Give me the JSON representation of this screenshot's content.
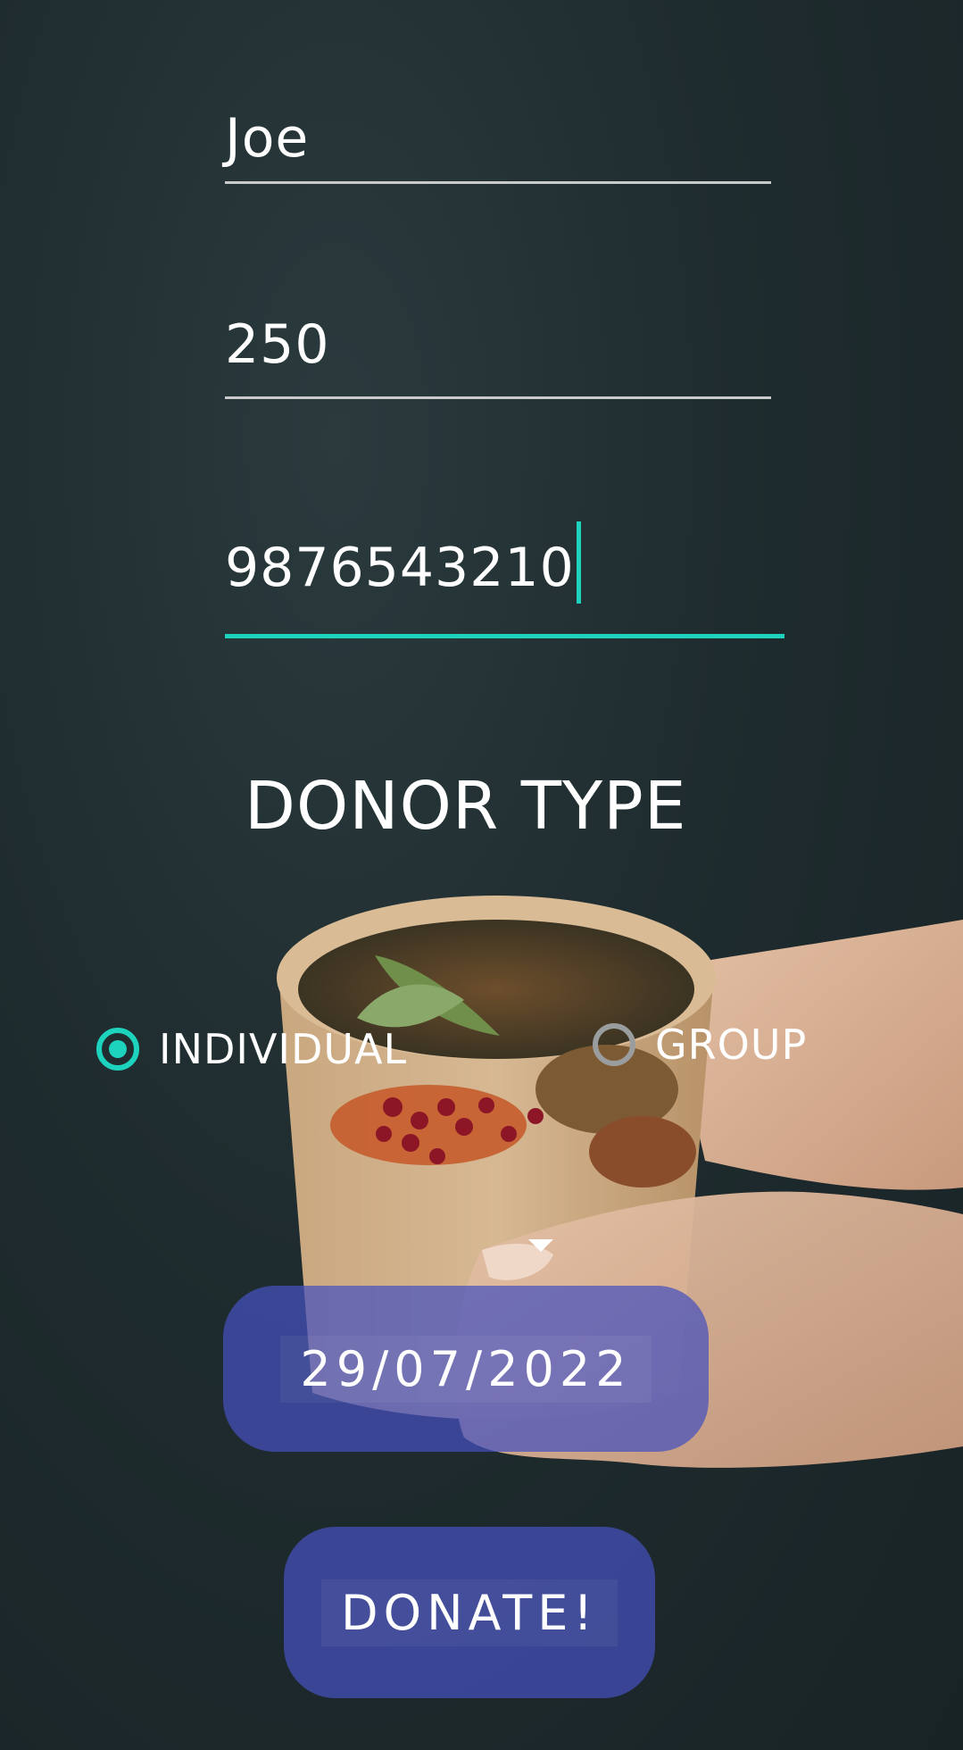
{
  "form": {
    "name_value": "Joe",
    "amount_value": "250",
    "phone_value": "9876543210"
  },
  "donor_type": {
    "title": "DONOR TYPE",
    "options": [
      {
        "label": "INDIVIDUAL",
        "checked": true
      },
      {
        "label": "GROUP",
        "checked": false
      }
    ]
  },
  "date_button": {
    "label": "29/07/2022"
  },
  "donate_button": {
    "label": "DONATE!"
  },
  "colors": {
    "accent": "#1dd3bd",
    "button": "#4550be",
    "background": "#1f2c2f"
  }
}
